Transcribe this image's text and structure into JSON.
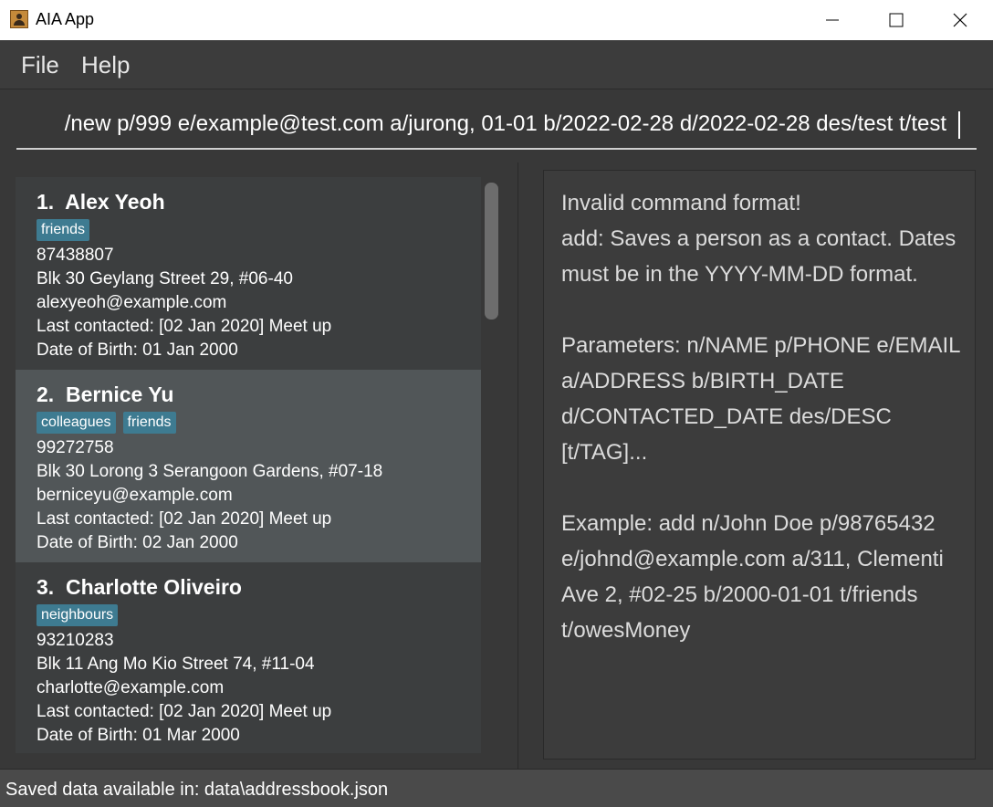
{
  "window": {
    "title": "AIA App",
    "icon": "address-book-icon"
  },
  "menu": {
    "file": "File",
    "help": "Help"
  },
  "command_box": {
    "value": "/new p/999 e/example@test.com a/jurong, 01-01 b/2022-02-28 d/2022-02-28 des/test t/test"
  },
  "persons": [
    {
      "index": "1.",
      "name": "Alex Yeoh",
      "tags": [
        "friends"
      ],
      "phone": "87438807",
      "address": "Blk 30 Geylang Street 29, #06-40",
      "email": "alexyeoh@example.com",
      "last_contacted": "Last contacted: [02 Jan 2020] Meet up",
      "birth": "Date of Birth: 01 Jan 2000"
    },
    {
      "index": "2.",
      "name": "Bernice Yu",
      "tags": [
        "colleagues",
        "friends"
      ],
      "phone": "99272758",
      "address": "Blk 30 Lorong 3 Serangoon Gardens, #07-18",
      "email": "berniceyu@example.com",
      "last_contacted": "Last contacted: [02 Jan 2020] Meet up",
      "birth": "Date of Birth: 02 Jan 2000"
    },
    {
      "index": "3.",
      "name": "Charlotte Oliveiro",
      "tags": [
        "neighbours"
      ],
      "phone": "93210283",
      "address": "Blk 11 Ang Mo Kio Street 74, #11-04",
      "email": "charlotte@example.com",
      "last_contacted": "Last contacted: [02 Jan 2020] Meet up",
      "birth": "Date of Birth: 01 Mar 2000"
    }
  ],
  "result_display": {
    "text": "Invalid command format!\nadd: Saves a person as a contact. Dates must be in the YYYY-MM-DD format.\n\nParameters: n/NAME p/PHONE e/EMAIL a/ADDRESS b/BIRTH_DATE d/CONTACTED_DATE des/DESC [t/TAG]...\n\nExample: add n/John Doe p/98765432 e/johnd@example.com a/311, Clementi Ave 2, #02-25 b/2000-01-01 t/friends t/owesMoney"
  },
  "status_bar": {
    "text": "Saved data available in: data\\addressbook.json"
  },
  "colors": {
    "tag": "#3e7b91",
    "selected_card": "#515658",
    "background": "#383838"
  }
}
